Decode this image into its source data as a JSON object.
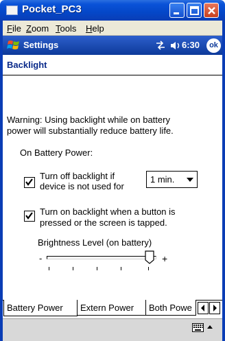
{
  "window": {
    "title": "Pocket_PC3"
  },
  "menubar": {
    "items": [
      {
        "underline": "F",
        "rest": "ile"
      },
      {
        "underline": "Z",
        "rest": "oom"
      },
      {
        "underline": "T",
        "rest": "ools"
      },
      {
        "underline": "H",
        "rest": "elp"
      }
    ]
  },
  "navbar": {
    "title": "Settings",
    "time": "6:30",
    "ok_label": "ok",
    "start_icon": "windows-flag-icon"
  },
  "page": {
    "heading": "Backlight",
    "warning": [
      "Warning: Using backlight while on battery",
      "power will substantially reduce battery life."
    ],
    "section_label": "On Battery Power:",
    "option1_lines": [
      "Turn off backlight if",
      "device is not used for"
    ],
    "option1_checked": true,
    "timeout_value": "1 min.",
    "option2_lines": [
      "Turn on backlight when a button is",
      "pressed or the screen is tapped."
    ],
    "option2_checked": true,
    "brightness_label": "Brightness Level (on battery)",
    "brightness_min": "-",
    "brightness_max": "+",
    "brightness_level": 1.0
  },
  "tabs": [
    {
      "label": "Battery Power",
      "active": true
    },
    {
      "label": "Extern Power",
      "active": false
    },
    {
      "label": "Both Powe",
      "active": false
    }
  ],
  "colors": {
    "titlebar": "#0447c8",
    "navbar": "#0d3a9a",
    "heading": "#0a2a8a"
  }
}
